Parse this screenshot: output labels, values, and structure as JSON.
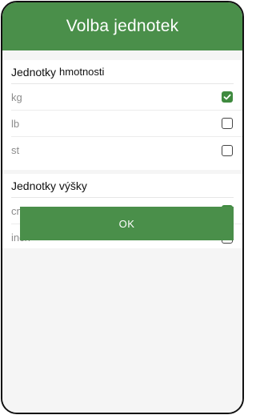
{
  "header": {
    "title": "Volba jednotek"
  },
  "weight": {
    "title_a": "Jednotky",
    "title_b": "hmotnosti",
    "options": [
      {
        "label": "kg",
        "checked": true
      },
      {
        "label": "lb",
        "checked": false
      },
      {
        "label": "st",
        "checked": false
      }
    ]
  },
  "height": {
    "title": "Jednotky výšky",
    "options": [
      {
        "label": "cm",
        "checked": true
      },
      {
        "label": "inch",
        "checked": false
      }
    ]
  },
  "actions": {
    "ok_label": "OK"
  },
  "colors": {
    "accent": "#4a8f4a",
    "checked": "#3f8a3f"
  }
}
